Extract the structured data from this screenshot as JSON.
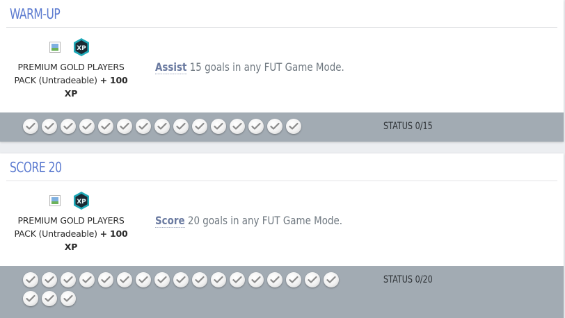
{
  "challenges": [
    {
      "title": "WARM-UP",
      "xp_badge": "XP",
      "reward_name": "PREMIUM GOLD PLAYERS PACK (Untradeable)",
      "reward_bonus": "+ 100 XP",
      "objective_keyword": "Assist",
      "objective_text": "15 goals in any FUT Game Mode.",
      "status": "STATUS 0/15",
      "check_count": 15
    },
    {
      "title": "SCORE 20",
      "xp_badge": "XP",
      "reward_name": "PREMIUM GOLD PLAYERS PACK (Untradeable)",
      "reward_bonus": "+ 100 XP",
      "objective_keyword": "Score",
      "objective_text": "20 goals in any FUT Game Mode.",
      "status": "STATUS 0/20",
      "check_count": 20
    }
  ],
  "colors": {
    "title": "#5c7bd0",
    "progress_bar": "#a2abb3",
    "xp_badge": "#1fa9b8"
  },
  "icons": {
    "check": "check-circle-icon",
    "xp": "xp-hexagon-icon",
    "broken_image": "broken-image-icon"
  }
}
